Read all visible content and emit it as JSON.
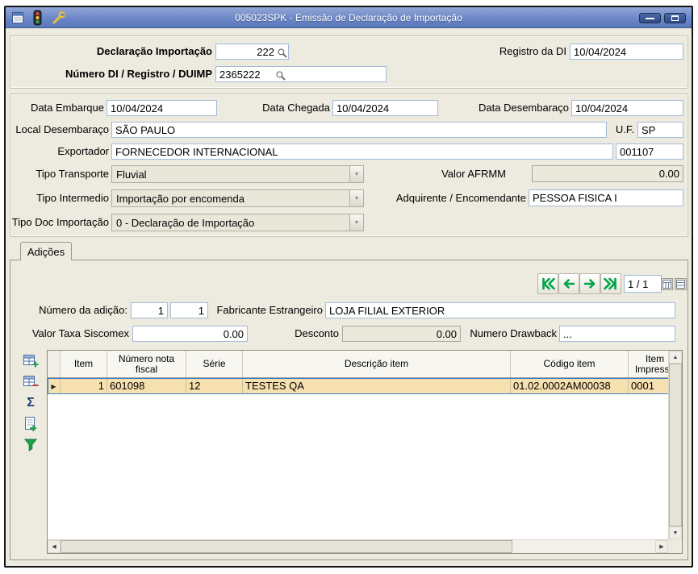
{
  "window": {
    "title": "005023SPK - Emissão de Declaração de Importação"
  },
  "colors": {
    "titlebar": "#6C87C6",
    "nav_green": "#00A346",
    "row_selected": "#F7E0AF"
  },
  "icons": {
    "row_indicator": "▶",
    "arrow_up": "▲",
    "arrow_down": "▼",
    "arrow_left": "◀",
    "arrow_right": "▶",
    "combo_arrow": "▼",
    "sum": "Σ"
  },
  "header": {
    "declaracao_importacao": {
      "label": "Declaração Importação",
      "value": "222"
    },
    "registro_da_di": {
      "label": "Registro da DI",
      "value": "10/04/2024"
    },
    "numero_di": {
      "label": "Número DI / Registro / DUIMP",
      "value": "2365222"
    }
  },
  "details": {
    "data_embarque": {
      "label": "Data Embarque",
      "value": "10/04/2024"
    },
    "data_chegada": {
      "label": "Data Chegada",
      "value": "10/04/2024"
    },
    "data_desembaraco": {
      "label": "Data Desembaraço",
      "value": "10/04/2024"
    },
    "local_desembaraco": {
      "label": "Local Desembaraço",
      "value": "SÃO PAULO"
    },
    "uf": {
      "label": "U.F.",
      "value": "SP"
    },
    "exportador": {
      "label": "Exportador",
      "value": "FORNECEDOR INTERNACIONAL",
      "code": "001107"
    },
    "tipo_transporte": {
      "label": "Tipo Transporte",
      "value": "Fluvial"
    },
    "valor_afrmm": {
      "label": "Valor AFRMM",
      "value": "0.00"
    },
    "tipo_intermedio": {
      "label": "Tipo Intermedio",
      "value": "Importação por encomenda"
    },
    "adquirente": {
      "label": "Adquirente / Encomendante",
      "value": "PESSOA FISICA I"
    },
    "tipo_doc_importacao": {
      "label": "Tipo Doc Importação",
      "value": "0 - Declaração de Importação"
    }
  },
  "tabs": {
    "adicoes": "Adições"
  },
  "adicao": {
    "pager": "1 / 1",
    "numero_adicao": {
      "label": "Número da adição:",
      "value1": "1",
      "value2": "1"
    },
    "fabricante": {
      "label": "Fabricante Estrangeiro",
      "value": "LOJA FILIAL EXTERIOR"
    },
    "valor_taxa_siscomex": {
      "label": "Valor Taxa Siscomex",
      "value": "0.00"
    },
    "desconto": {
      "label": "Desconto",
      "value": "0.00"
    },
    "numero_drawback": {
      "label": "Numero Drawback",
      "value": "..."
    }
  },
  "grid": {
    "columns": [
      "Item",
      "Número nota fiscal",
      "Série",
      "Descrição item",
      "Código item",
      "Item Impressã"
    ],
    "rows": [
      {
        "item": "1",
        "nota": "601098",
        "serie": "12",
        "descricao": "TESTES QA",
        "codigo": "01.02.0002AM00038",
        "impressao": "0001"
      }
    ]
  }
}
